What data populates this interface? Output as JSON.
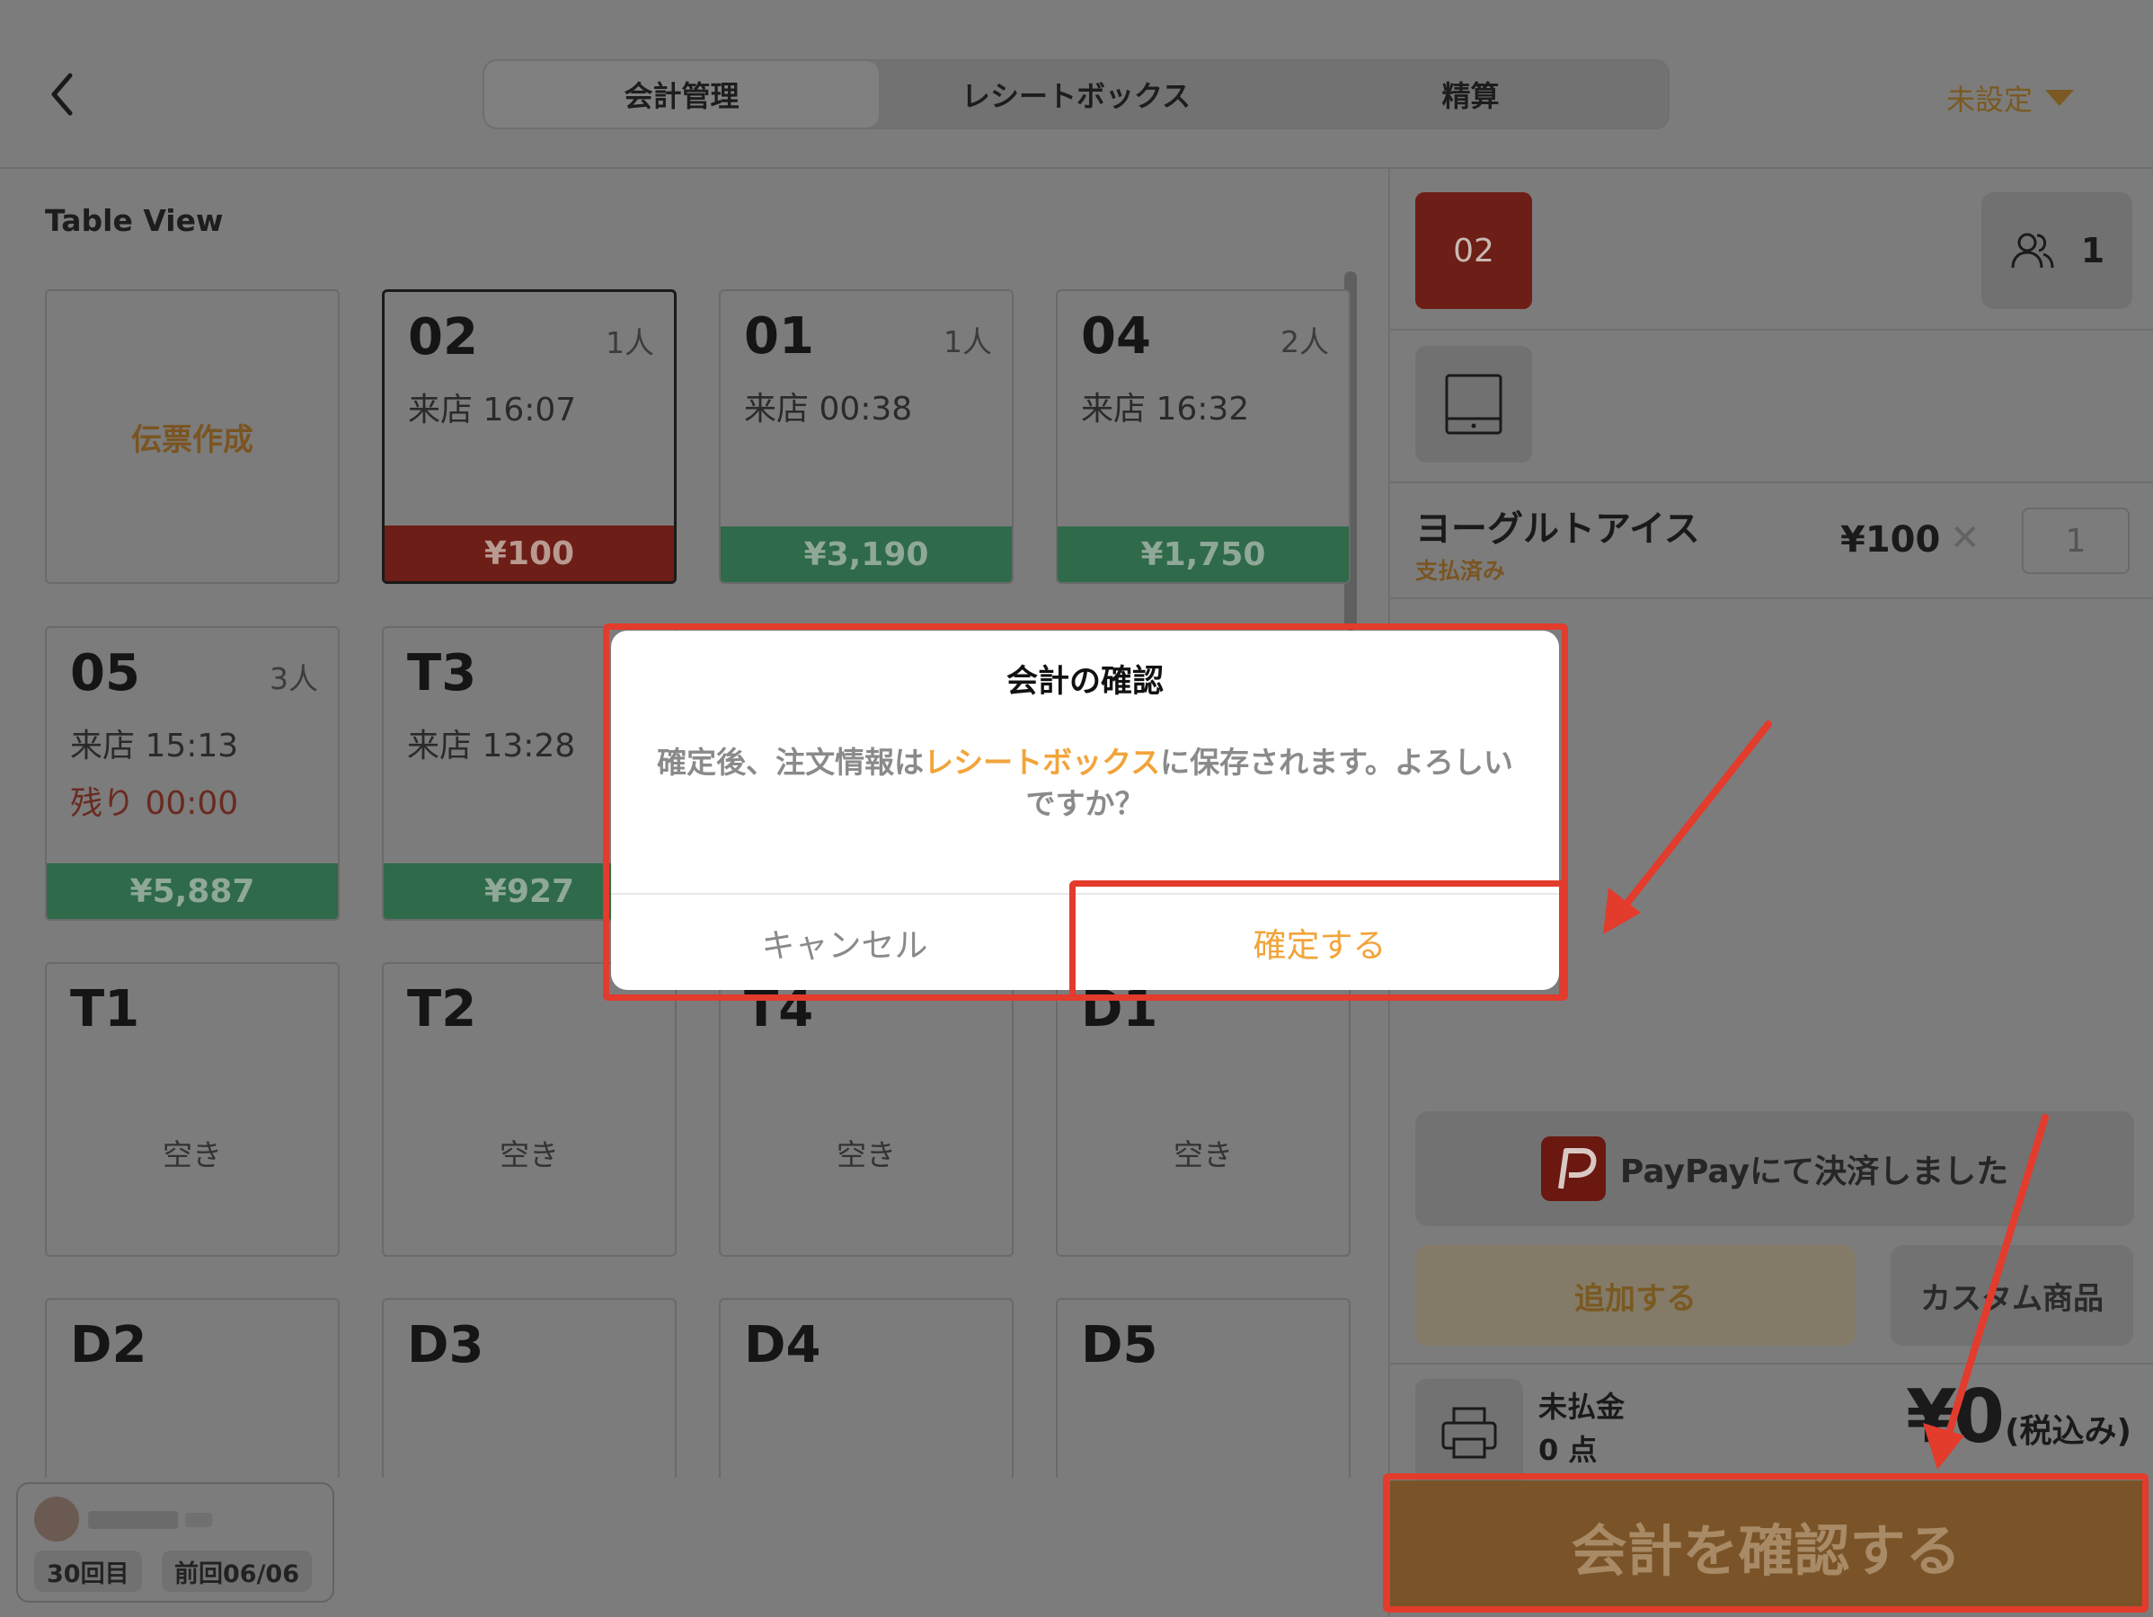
{
  "header": {
    "tabs": [
      {
        "label": "会計管理",
        "active": true
      },
      {
        "label": "レシートボックス",
        "active": false
      },
      {
        "label": "精算",
        "active": false
      }
    ],
    "unset_label": "未設定"
  },
  "table_view": {
    "title": "Table View",
    "create_label": "伝票作成",
    "tables": [
      {
        "no": "02",
        "people": "1人",
        "arrival": "来店 16:07",
        "amount": "¥100"
      },
      {
        "no": "01",
        "people": "1人",
        "arrival": "来店 00:38",
        "amount": "¥3,190"
      },
      {
        "no": "04",
        "people": "2人",
        "arrival": "来店 16:32",
        "amount": "¥1,750"
      },
      {
        "no": "05",
        "people": "3人",
        "arrival": "来店 15:13",
        "remaining": "残り 00:00",
        "amount": "¥5,887"
      },
      {
        "no": "T3",
        "arrival": "来店 13:28",
        "amount": "¥927"
      },
      {
        "no": "T1",
        "status": "空き"
      },
      {
        "no": "T2",
        "status": "空き"
      },
      {
        "no": "T4",
        "status": "空き"
      },
      {
        "no": "D1",
        "status": "空き"
      },
      {
        "no": "D2"
      },
      {
        "no": "D3"
      },
      {
        "no": "D4"
      },
      {
        "no": "D5"
      }
    ]
  },
  "user": {
    "visits": "30回目",
    "last_visit": "前回06/06"
  },
  "order": {
    "table_no": "02",
    "people_count": "1",
    "item": {
      "name": "ヨーグルトアイス",
      "status": "支払済み",
      "price": "¥100",
      "qty": "1"
    },
    "paypay_label": "PayPayにて決済しました",
    "add_label": "追加する",
    "custom_label": "カスタム商品",
    "unpaid_label": "未払金",
    "unpaid_count": "0 点",
    "total": "¥0",
    "tax_label": "(税込み)",
    "confirm_label": "会計を確認する"
  },
  "dialog": {
    "title": "会計の確認",
    "message_before": "確定後、注文情報は",
    "message_highlight": "レシートボックス",
    "message_after": "に保存されます。よろしいですか？",
    "cancel_label": "キャンセル",
    "confirm_label": "確定する"
  },
  "colors": {
    "accent": "#f2a43a",
    "annotation": "#e33b2c",
    "selected_table": "#6d1e16",
    "amount_bar": "#2f6a4a"
  }
}
